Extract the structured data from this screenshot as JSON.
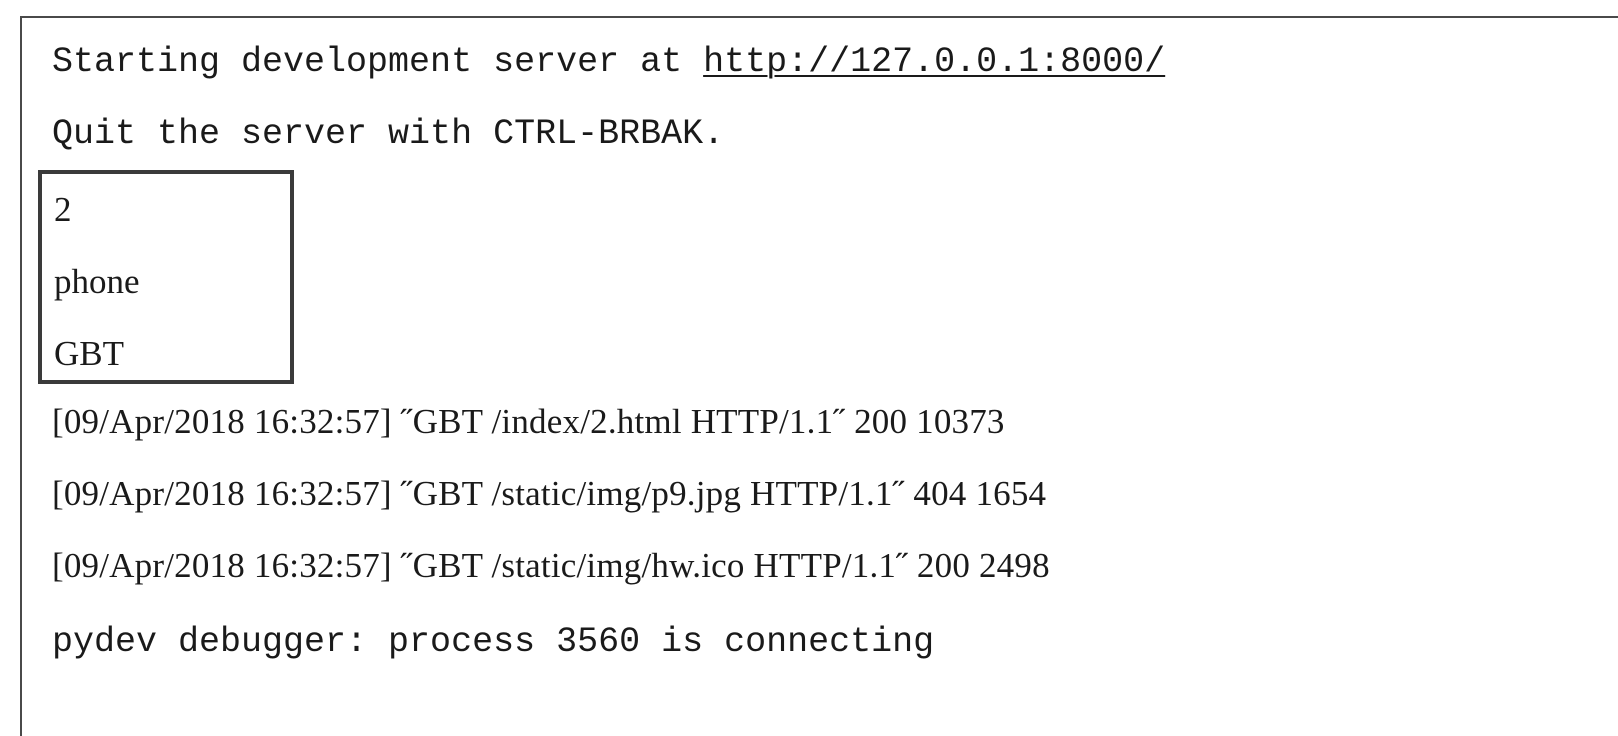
{
  "console": {
    "server_start_prefix": "Starting development server at ",
    "server_url": "http://127.0.0.1:8000/",
    "quit_hint": "Quit the server with CTRL-BRBAK.",
    "highlighted_output": {
      "line1": "2",
      "line2": "phone",
      "line3": "GBT"
    },
    "log_lines": [
      "[09/Apr/2018 16:32:57] ˝GBT /index/2.html HTTP/1.1˝ 200 10373",
      "[09/Apr/2018 16:32:57] ˝GBT /static/img/p9.jpg HTTP/1.1˝ 404 1654",
      "[09/Apr/2018 16:32:57] ˝GBT /static/img/hw.ico HTTP/1.1˝ 200 2498"
    ],
    "debugger_line": "pydev debugger: process 3560 is connecting"
  }
}
